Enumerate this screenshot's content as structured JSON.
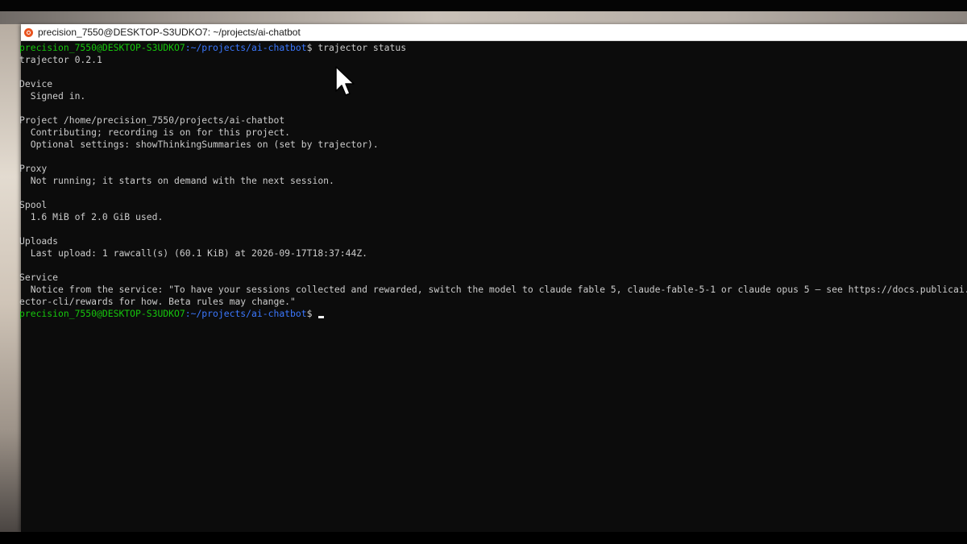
{
  "window": {
    "title": "precision_7550@DESKTOP-S3UDKO7: ~/projects/ai-chatbot",
    "icon": "ubuntu-icon"
  },
  "colors": {
    "prompt_user": "#16c60c",
    "prompt_path": "#3b78ff",
    "text": "#cccccc",
    "background": "#0c0c0c"
  },
  "terminal": {
    "prompt": {
      "user_host": "precision_7550@DESKTOP-S3UDKO7",
      "path": ":~/projects/ai-chatbot",
      "dollar": "$"
    },
    "command": " trajector status",
    "lines": [
      "trajector 0.2.1",
      "",
      "Device",
      "  Signed in.",
      "",
      "Project /home/precision_7550/projects/ai-chatbot",
      "  Contributing; recording is on for this project.",
      "  Optional settings: showThinkingSummaries on (set by trajector).",
      "",
      "Proxy",
      "  Not running; it starts on demand with the next session.",
      "",
      "Spool",
      "  1.6 MiB of 2.0 GiB used.",
      "",
      "Uploads",
      "  Last upload: 1 rawcall(s) (60.1 KiB) at 2026-09-17T18:37:44Z.",
      "",
      "Service",
      "  Notice from the service: \"To have your sessions collected and rewarded, switch the model to claude fable 5, claude-fable-5-1 or claude opus 5 — see https://docs.publicai.io",
      "ector-cli/rewards for how. Beta rules may change.\""
    ]
  }
}
